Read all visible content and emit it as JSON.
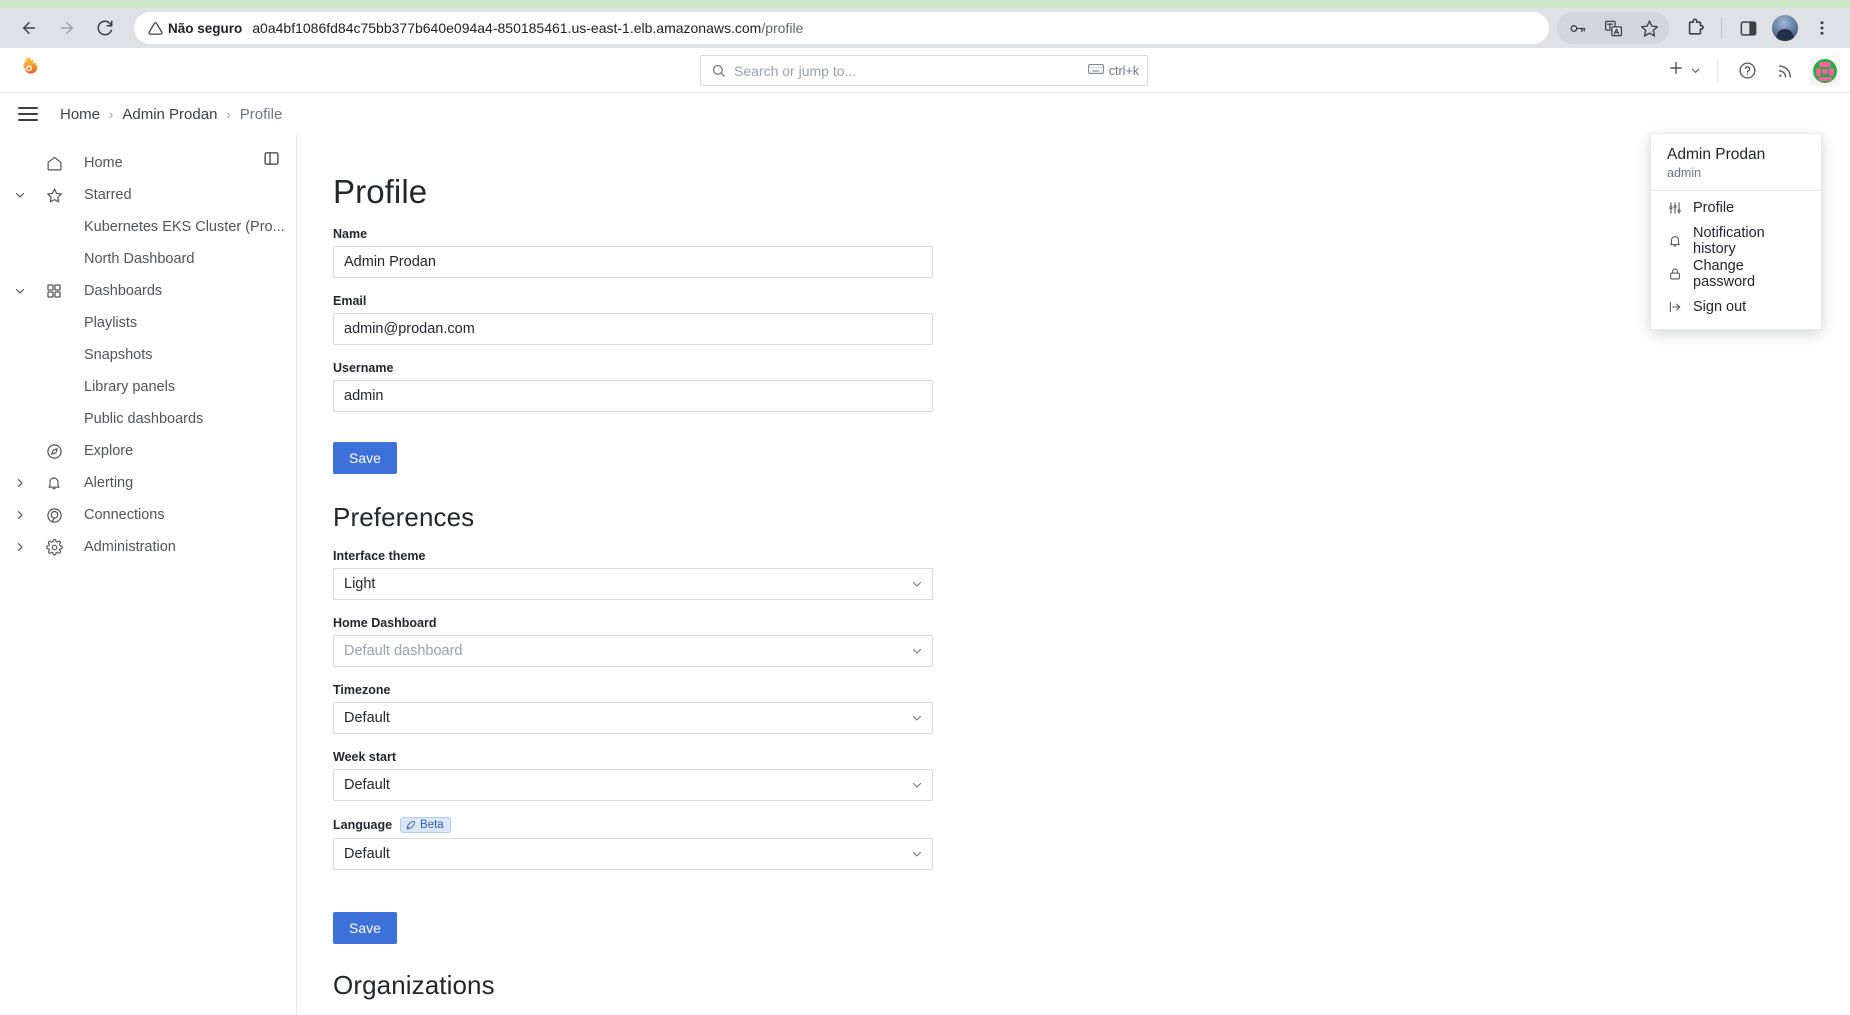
{
  "browser": {
    "back_icon": "arrow-left-icon",
    "forward_icon": "arrow-right-icon",
    "reload_icon": "reload-icon",
    "security_label": "Não seguro",
    "url_host": "a0a4bf1086fd84c75bb377b640e094a4-850185461.us-east-1.elb.amazonaws.com",
    "url_path": "/profile",
    "icons": {
      "password": "key-icon",
      "translate": "translate-icon",
      "bookmark": "star-icon",
      "extensions": "puzzle-icon",
      "side_panel": "side-panel-icon",
      "menu": "three-dot-menu-icon"
    }
  },
  "topnav": {
    "logo": "grafana-logo",
    "search": {
      "placeholder": "Search or jump to...",
      "shortcut": "ctrl+k",
      "icon": "search-icon",
      "kbd_icon": "keyboard-icon"
    },
    "add_label": "",
    "icons": {
      "plus": "plus-icon",
      "chevron": "chevron-down-icon",
      "help": "help-circle-icon",
      "news": "rss-news-icon"
    }
  },
  "breadcrumb": {
    "menu_icon": "hamburger-menu-icon",
    "items": [
      {
        "label": "Home",
        "current": false
      },
      {
        "label": "Admin Prodan",
        "current": false
      },
      {
        "label": "Profile",
        "current": true
      }
    ],
    "separator": "›"
  },
  "sidebar": {
    "dock_icon": "dock-panel-icon",
    "items": [
      {
        "label": "Home",
        "icon": "home-icon",
        "chevron": "",
        "child": false
      },
      {
        "label": "Starred",
        "icon": "star-icon",
        "chevron": "down",
        "child": false
      },
      {
        "label": "Kubernetes EKS Cluster (Pro...",
        "icon": "",
        "chevron": "",
        "child": true
      },
      {
        "label": "North Dashboard",
        "icon": "",
        "chevron": "",
        "child": true
      },
      {
        "label": "Dashboards",
        "icon": "apps-grid-icon",
        "chevron": "down",
        "child": false
      },
      {
        "label": "Playlists",
        "icon": "",
        "chevron": "",
        "child": true
      },
      {
        "label": "Snapshots",
        "icon": "",
        "chevron": "",
        "child": true
      },
      {
        "label": "Library panels",
        "icon": "",
        "chevron": "",
        "child": true
      },
      {
        "label": "Public dashboards",
        "icon": "",
        "chevron": "",
        "child": true
      },
      {
        "label": "Explore",
        "icon": "compass-icon",
        "chevron": "",
        "child": false
      },
      {
        "label": "Alerting",
        "icon": "bell-icon",
        "chevron": "right",
        "child": false
      },
      {
        "label": "Connections",
        "icon": "connections-icon",
        "chevron": "right",
        "child": false
      },
      {
        "label": "Administration",
        "icon": "gear-icon",
        "chevron": "right",
        "child": false
      }
    ]
  },
  "profile": {
    "title": "Profile",
    "fields": [
      {
        "label": "Name",
        "value": "Admin Prodan"
      },
      {
        "label": "Email",
        "value": "admin@prodan.com"
      },
      {
        "label": "Username",
        "value": "admin"
      }
    ],
    "save_label": "Save"
  },
  "preferences": {
    "title": "Preferences",
    "fields": [
      {
        "label": "Interface theme",
        "value": "Light",
        "is_placeholder": false,
        "badge": ""
      },
      {
        "label": "Home Dashboard",
        "value": "Default dashboard",
        "is_placeholder": true,
        "badge": ""
      },
      {
        "label": "Timezone",
        "value": "Default",
        "is_placeholder": false,
        "badge": ""
      },
      {
        "label": "Week start",
        "value": "Default",
        "is_placeholder": false,
        "badge": ""
      },
      {
        "label": "Language",
        "value": "Default",
        "is_placeholder": false,
        "badge": "Beta"
      }
    ],
    "save_label": "Save"
  },
  "organizations": {
    "title": "Organizations"
  },
  "user_dropdown": {
    "name": "Admin Prodan",
    "login": "admin",
    "items": [
      {
        "label": "Profile",
        "icon": "sliders-icon"
      },
      {
        "label": "Notification history",
        "icon": "bell-icon"
      },
      {
        "label": "Change password",
        "icon": "lock-icon"
      },
      {
        "label": "Sign out",
        "icon": "sign-out-icon"
      }
    ]
  },
  "colors": {
    "accent_blue": "#3d71d9",
    "grafana_orange": "#f05a28",
    "beta_badge_bg": "#dce6f8",
    "beta_badge_text": "#2a5fb5",
    "avatar_green": "#27ae3f",
    "avatar_pink": "#f062a0"
  }
}
